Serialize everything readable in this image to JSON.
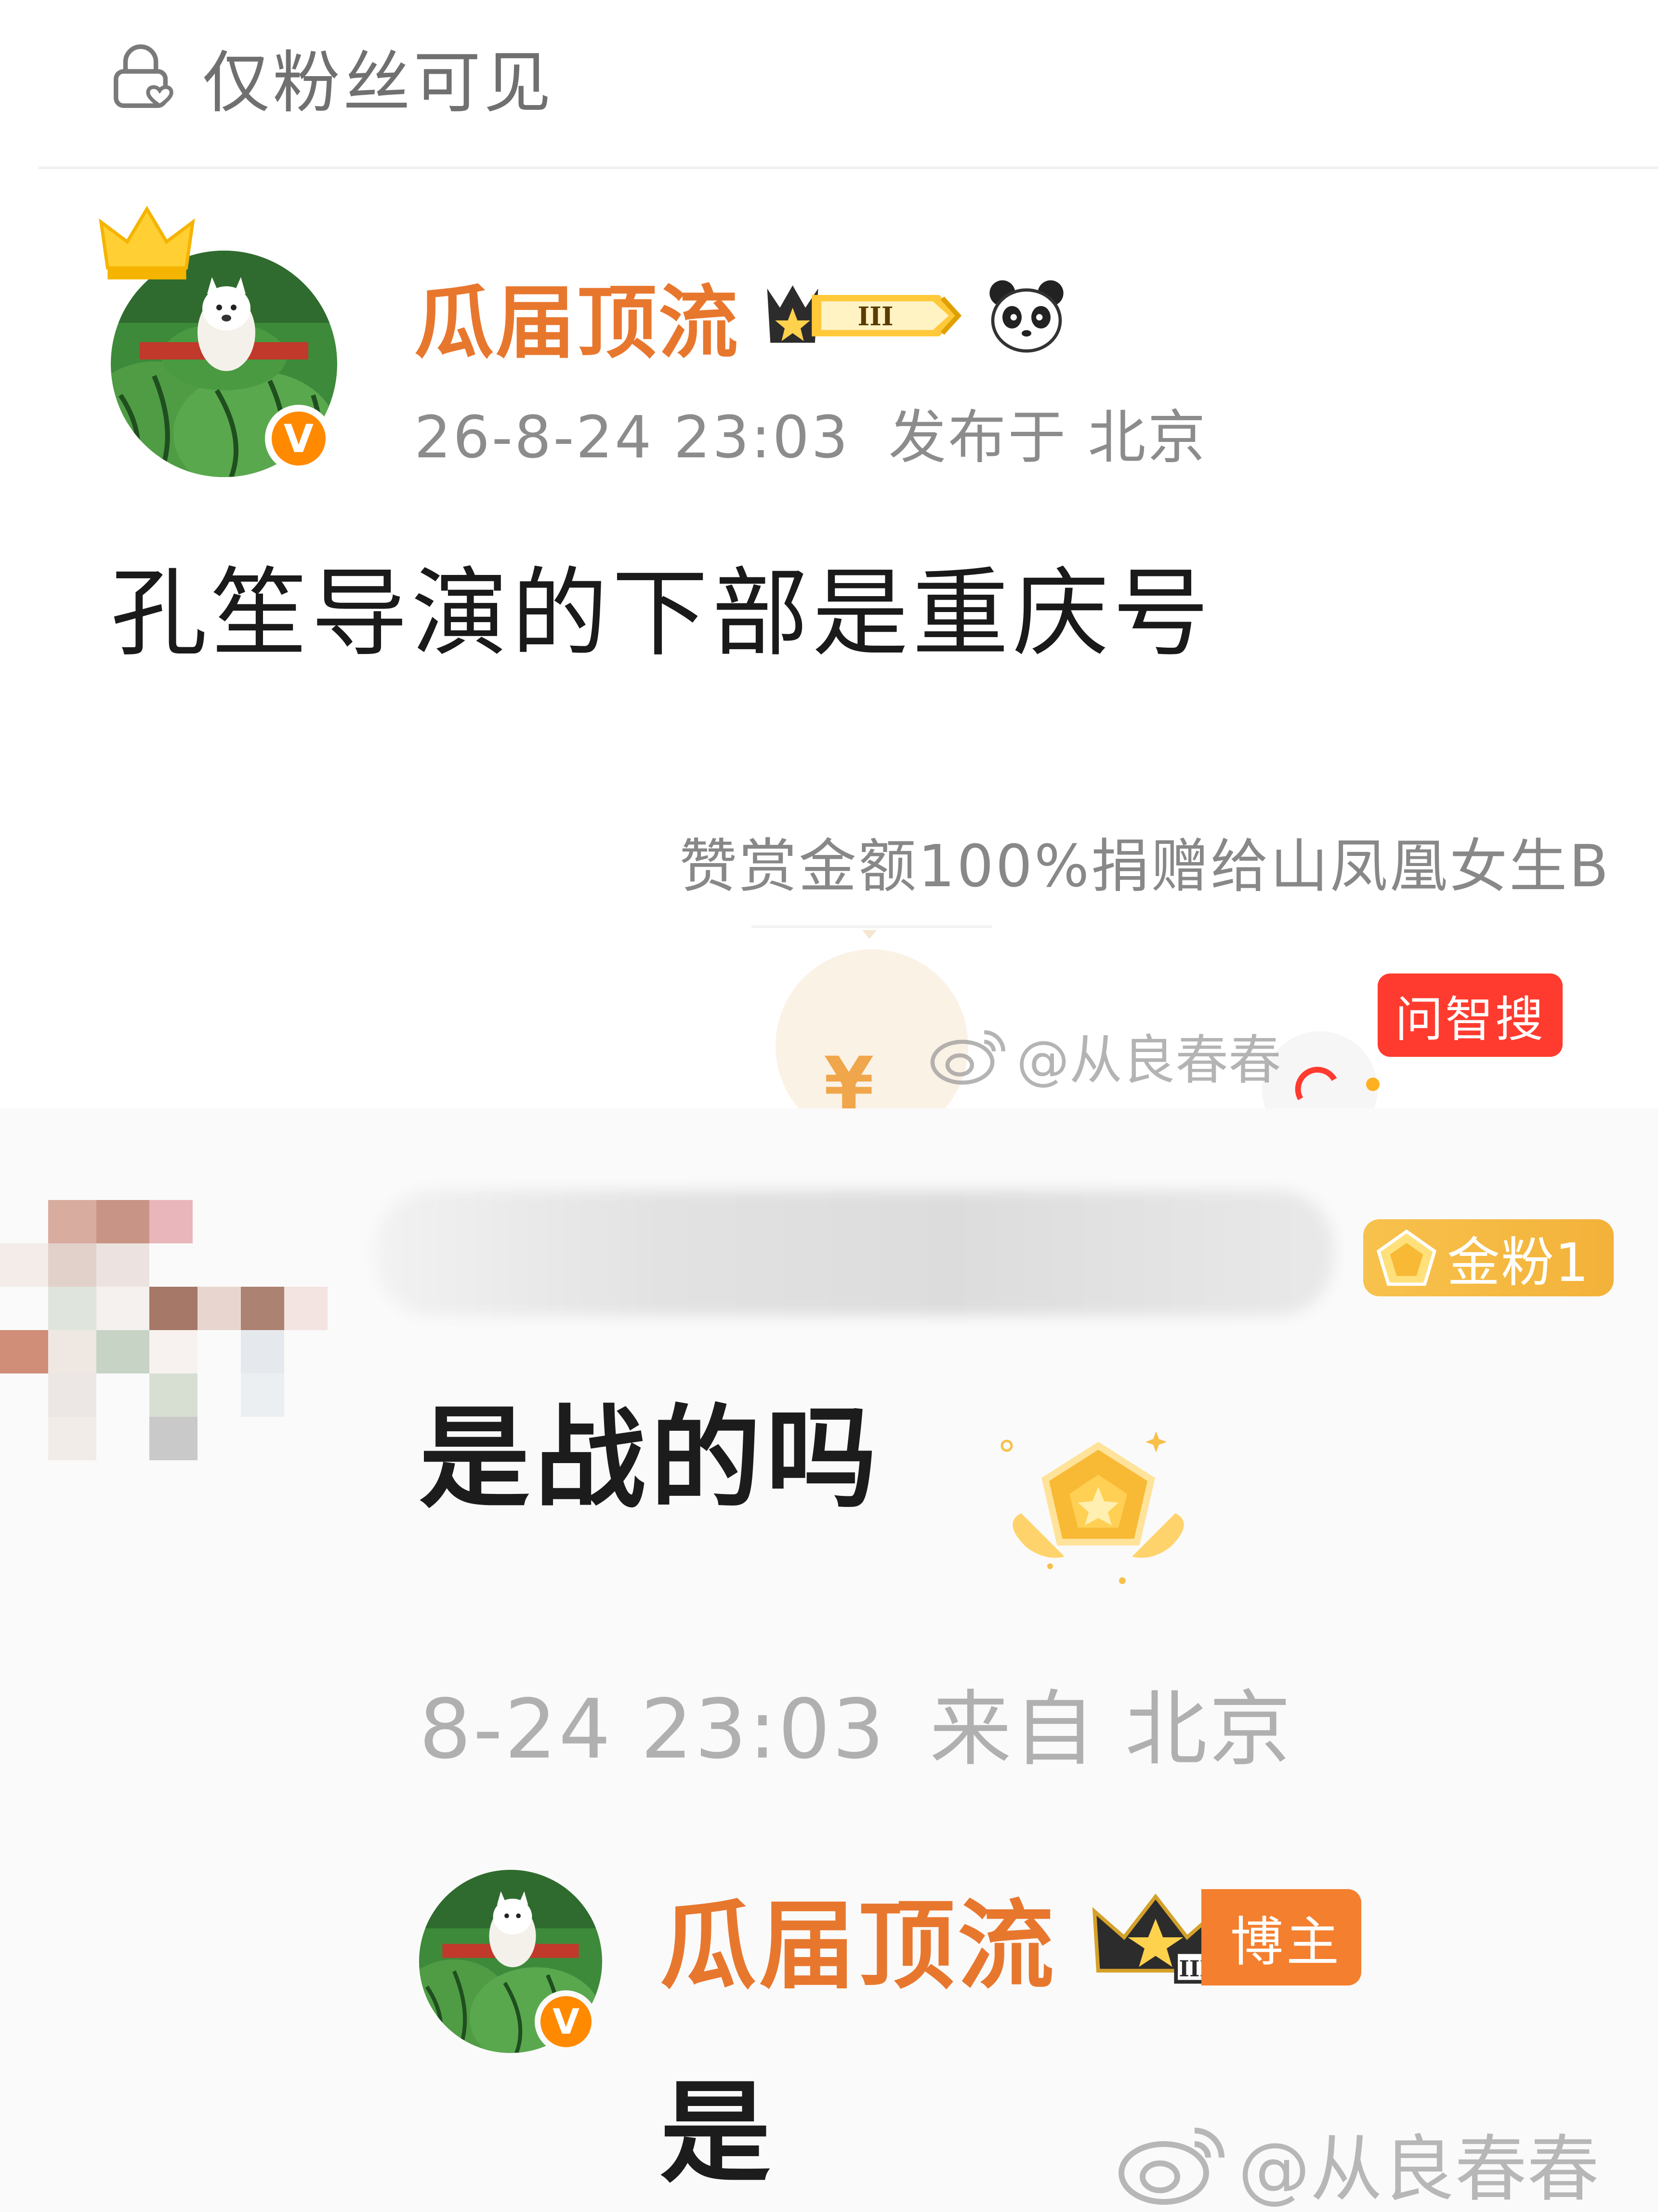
{
  "top_post": {
    "visibility_label": "仅粉丝可见",
    "author": {
      "name": "瓜届顶流",
      "member_level": "III",
      "verified_mark": "V"
    },
    "timestamp": "26-8-24 23:03",
    "location": "发布于 北京",
    "content": "孔笙导演的下部是重庆号",
    "donation_text": "赞赏金额100%捐赠给山凤凰女生B",
    "wenzhisou_tag": "问智搜",
    "watermark": "@从良春春"
  },
  "comment": {
    "fan_badge": "金粉1",
    "content": "是战的吗",
    "timestamp": "8-24 23:03",
    "location": "来自 北京",
    "reply": {
      "author_name": "瓜届顶流",
      "member_level": "III",
      "role_tag": "博主",
      "verified_mark": "V",
      "content": "是"
    },
    "watermark": "@从良春春"
  },
  "colors": {
    "username": "#e8772e",
    "verified": "#ff8a00",
    "wenzhisou": "#ff3b2f",
    "gold_badge": "#f3b23a",
    "meta_text": "#8c8c8c"
  },
  "icons": [
    "lock-heart-icon",
    "crown-icon",
    "member-level-badge",
    "panda-icon",
    "weibo-logo-icon",
    "gold-fan-icon",
    "medal-icon"
  ]
}
